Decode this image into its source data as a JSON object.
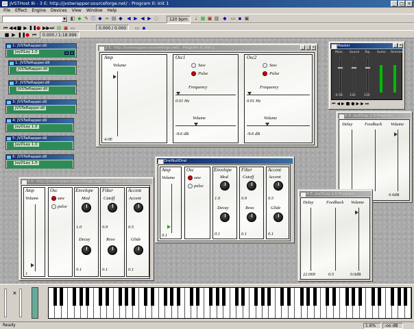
{
  "app": {
    "title": "JVSTHost 8i - 3 E: http://jvstwrapper.sourceforge.net/ : Program 0: Init 1"
  },
  "menu": [
    "File",
    "Effect",
    "Engine",
    "Devices",
    "View",
    "Window",
    "Help"
  ],
  "toolbar": {
    "bpm": "120 bpm",
    "time1": "0.000 / 0.000",
    "time2": "0.000 / 1:18.999"
  },
  "mini_plugins": [
    {
      "title": "1: JVSTwRapper.dll",
      "label": "JayDLay 1.0"
    },
    {
      "title": "1: JVSTwRapper.dll",
      "label": "JVSTwRapper.dll"
    },
    {
      "title": "2: JVSTwRapper.dll",
      "label": "JVSTwRapper.dll"
    },
    {
      "title": "3: JVSTwRapper.dll",
      "label": "JVSTwRapper.dll"
    },
    {
      "title": "4: JVSTwRapper.dll",
      "label": "JayDLay 1.0"
    },
    {
      "title": "5: JVSTwRapper.dll",
      "label": "JayDLay 1.0"
    },
    {
      "title": "6: JVSTwRapper.dll",
      "label": "JayDLay 1.0"
    }
  ],
  "win_synth1": {
    "title": "2 E: http://jvstwrapper.sourceforge.net/ : Program 0: Init 1",
    "amp": {
      "head": "Amp",
      "label": "Volume",
      "value": "4.0E"
    },
    "osc1": {
      "head": "Osc1",
      "saw": "Saw",
      "pulse": "Pulse",
      "freq_label": "Frequency",
      "freq_value": "0.01 Hz",
      "vol_label": "Volume",
      "vol_value": "-9.6 dB"
    },
    "osc2": {
      "head": "Osc2",
      "saw": "Saw",
      "pulse": "Pulse",
      "freq_label": "Frequency",
      "freq_value": "0.01 Hz",
      "vol_label": "Volume",
      "vol_value": "-9.6 dB"
    }
  },
  "win_synth2": {
    "title": "3 E: http://jvstwrapper.sourceforge.net/ : Program 0: Init 1",
    "amp": {
      "head": "Amp",
      "label": "Volume",
      "value": "1"
    },
    "osc": {
      "head": "Osc",
      "saw": "saw",
      "pulse": "pulse"
    },
    "envelope": {
      "head": "Envelope",
      "mod": "Mod",
      "mod_val": "1.0",
      "decay": "Decay",
      "decay_val": "0.1"
    },
    "filter": {
      "head": "Filter",
      "cutoff": "Cutoff",
      "cutoff_val": "0.9",
      "reso": "Reso",
      "reso_val": "0.1"
    },
    "accent": {
      "head": "Accent",
      "accent": "Accent",
      "accent_val": "0.5",
      "glide": "Glide",
      "glide_val": "0.1"
    }
  },
  "win_synth3": {
    "title": "DreiNullDrei",
    "amp": {
      "head": "Amp",
      "label": "Volume",
      "value": "0.1"
    },
    "osc": {
      "head": "Osc",
      "saw": "saw",
      "pulse": "pulse"
    },
    "envelope": {
      "head": "Envelope",
      "mod": "Mod",
      "mod_val": "1.0",
      "decay": "Decay",
      "decay_val": "0.1"
    },
    "filter": {
      "head": "Filter",
      "cutoff": "Cutoff",
      "cutoff_val": "0.9",
      "reso": "Reso",
      "reso_val": "0.1"
    },
    "accent": {
      "head": "Accent",
      "accent": "Accent",
      "accent_val": "0.5",
      "glide": "Glide",
      "glide_val": "0.1"
    }
  },
  "master": {
    "title": "Master",
    "labels": [
      "Main",
      "Sound",
      "Tap",
      "Sumo",
      "Remote"
    ],
    "values": [
      "-9.5B",
      "130",
      "130",
      "",
      ""
    ]
  },
  "delay1": {
    "title": "6 E: JayDLay 1.0 Program",
    "delay": "Delay",
    "feedback": "Feedback",
    "volume": "Volume",
    "vol_val": "0.0dB"
  },
  "delay2": {
    "title": "4 E: JayDLay 1.0 Program",
    "delay": "Delay",
    "feedback": "Feedback",
    "volume": "Volume",
    "delay_val": "22.069",
    "fb_val": "0.5",
    "vol_val": "0.0dB"
  },
  "status": {
    "ready": "Ready",
    "cpu": "1.6%",
    "db": "-oo dB"
  }
}
